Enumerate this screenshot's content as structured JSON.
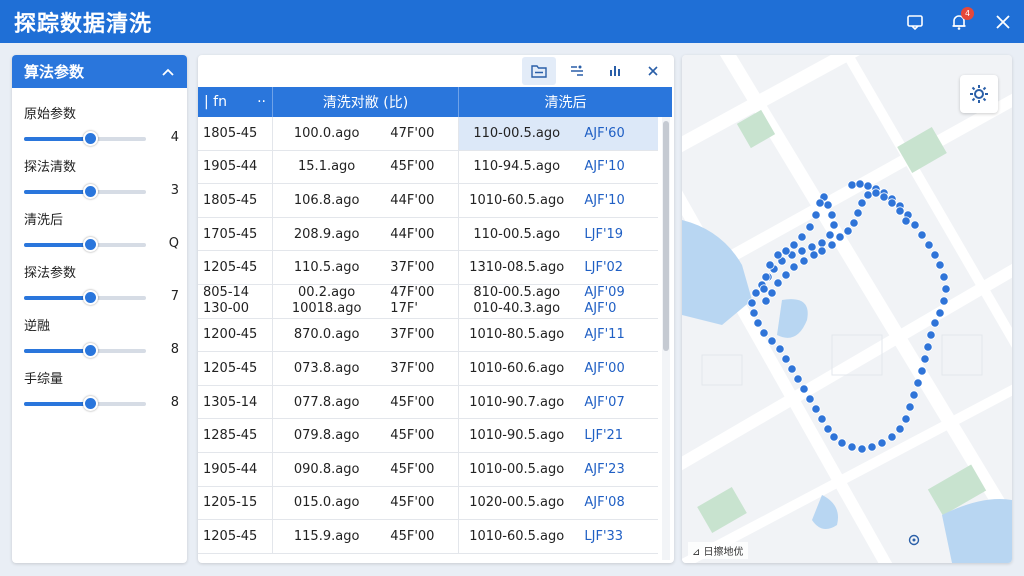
{
  "app": {
    "title": "探踪数据清洗",
    "notification_count": "4"
  },
  "params_panel": {
    "title": "算法参数",
    "items": [
      {
        "label": "原始参数",
        "value": "4",
        "level": 0.54
      },
      {
        "label": "探法清数",
        "value": "3",
        "level": 0.54
      },
      {
        "label": "清洗后",
        "value": "Q",
        "level": 0.54
      },
      {
        "label": "探法参数",
        "value": "7",
        "level": 0.54
      },
      {
        "label": "逆融",
        "value": "8",
        "level": 0.54
      },
      {
        "label": "手综量",
        "value": "8",
        "level": 0.54
      }
    ]
  },
  "table": {
    "headers": {
      "c1_left": "| fn",
      "c1_right": "··",
      "c2": "清洗对敝 (比)",
      "c3": "清洗后"
    },
    "rows": [
      {
        "id": "1805-45",
        "b1": "100.0.ago",
        "b2": "47F'00",
        "a1": "110-00.5.ago",
        "a2": "AJF'60",
        "highlight": true
      },
      {
        "id": "1905-44",
        "b1": "15.1.ago",
        "b2": "45F'00",
        "a1": "110-94.5.ago",
        "a2": "AJF'10"
      },
      {
        "id": "1805-45",
        "b1": "106.8.ago",
        "b2": "44F'00",
        "a1": "1010-60.5.ago",
        "a2": "AJF'10"
      },
      {
        "id": "1705-45",
        "b1": "208.9.ago",
        "b2": "44F'00",
        "a1": "110-00.5.ago",
        "a2": "LJF'19"
      },
      {
        "id": "1205-45",
        "b1": "110.5.ago",
        "b2": "37F'00",
        "a1": "1310-08.5.ago",
        "a2": "LJF'02"
      },
      {
        "id": "805-14",
        "id2": "130-00",
        "b1": "00.2.ago",
        "b1_2": "10018.ago",
        "b2": "47F'00",
        "b2_2": "17F'",
        "a1": "810-00.5.ago",
        "a1_2": "010-40.3.ago",
        "a2": "AJF'09",
        "a2_2": "AJF'0"
      },
      {
        "id": "1200-45",
        "b1": "870.0.ago",
        "b2": "37F'00",
        "a1": "1010-80.5.ago",
        "a2": "AJF'11"
      },
      {
        "id": "1205-45",
        "b1": "073.8.ago",
        "b2": "37F'00",
        "a1": "1010-60.6.ago",
        "a2": "AJF'00"
      },
      {
        "id": "1305-14",
        "b1": "077.8.ago",
        "b2": "45F'00",
        "a1": "1010-90.7.ago",
        "a2": "AJF'07"
      },
      {
        "id": "1285-45",
        "b1": "079.8.ago",
        "b2": "45F'00",
        "a1": "1010-90.5.ago",
        "a2": "LJF'21"
      },
      {
        "id": "1905-44",
        "b1": "090.8.ago",
        "b2": "45F'00",
        "a1": "1010-00.5.ago",
        "a2": "AJF'23"
      },
      {
        "id": "1205-15",
        "b1": "015.0.ago",
        "b2": "45F'00",
        "a1": "1020-00.5.ago",
        "a2": "AJF'08"
      },
      {
        "id": "1205-45",
        "b1": "115.9.ago",
        "b2": "45F'00",
        "a1": "1010-60.5.ago",
        "a2": "LJF'33"
      }
    ]
  },
  "map": {
    "attribution": "⊿ 日擦地优",
    "track_color": "#2f74d8"
  },
  "colors": {
    "accent": "#2a76dc",
    "titlebar": "#1f6fd6"
  }
}
